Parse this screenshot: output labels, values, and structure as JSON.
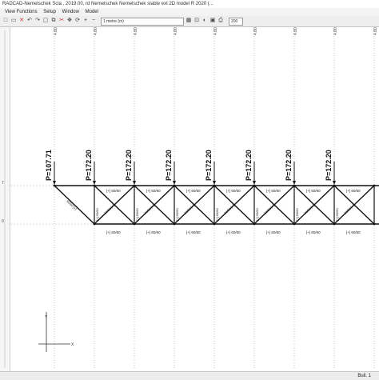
{
  "window": {
    "title": "RADCAD-Nemetschek Scia  , 2019.00, rd Nemetschek Nemetschek stable ext 2D model R 2020 (..."
  },
  "menu": [
    "View Functions",
    "Setup",
    "Window",
    "Model"
  ],
  "toolbar": {
    "combo_layer": "1 metre (m)",
    "combo_size": "200"
  },
  "canvas": {
    "top_ruler_label": "4.80",
    "force_labels": [
      "P=107.71",
      "P=172.20",
      "P=172.20",
      "P=172.20",
      "P=172.20",
      "P=172.20",
      "P=172.20",
      "P=172.20"
    ],
    "top_chord_section": "[+] 60/60",
    "bottom_chord_section": "[+] 60/60",
    "diagonal_label": "60/60 [+]",
    "vertical_label": "[+] 60/60",
    "left_markers": [
      "7",
      "0"
    ],
    "axis_y": "Y",
    "axis_x": "X"
  },
  "status": {
    "left": "",
    "right": "Buil. 1"
  }
}
